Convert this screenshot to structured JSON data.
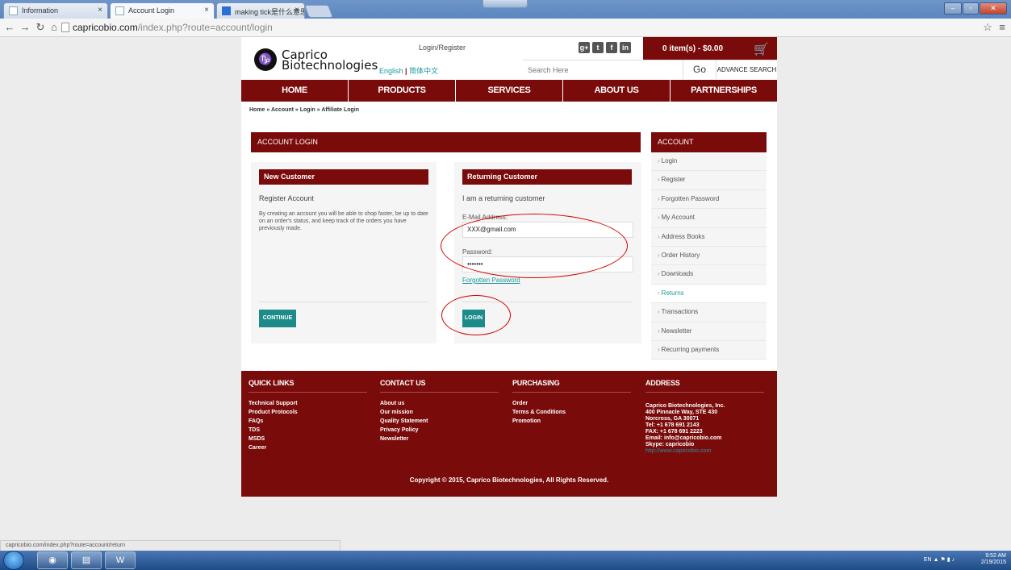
{
  "browser": {
    "tabs": [
      {
        "title": "Information",
        "active": false
      },
      {
        "title": "Account Login",
        "active": true
      },
      {
        "title": "making tick是什么意思_",
        "active": false
      }
    ],
    "tab_close": "×",
    "url_host": "capricobio.com",
    "url_path": "/index.php?route=account/login",
    "status_url": "capricobio.com/index.php?route=account/return"
  },
  "header": {
    "brand_line1": "Caprico",
    "brand_line2": "Biotechnologies",
    "logo_glyph": "♑",
    "login_register": "Login/Register",
    "lang_english": "English",
    "lang_chinese": "简体中文",
    "cart": "0 item(s) - $0.00",
    "search_placeholder": "Search Here",
    "go": "Go",
    "advance_search": "ADVANCE SEARCH",
    "social": [
      "g+",
      "t",
      "f",
      "in"
    ]
  },
  "nav": [
    "HOME",
    "PRODUCTS",
    "SERVICES",
    "ABOUT US",
    "PARTNERSHIPS"
  ],
  "breadcrumb": "Home » Account » Login » Affiliate Login",
  "account_login": {
    "title": "ACCOUNT LOGIN",
    "new_customer": {
      "heading": "New Customer",
      "subtitle": "Register Account",
      "text": "By creating an account you will be able to shop faster, be up to date on an order's status, and keep track of the orders you have previously made.",
      "button": "CONTINUE"
    },
    "returning_customer": {
      "heading": "Returning Customer",
      "subtitle": "I am a returning customer",
      "email_label": "E-Mail Address:",
      "email_value": "XXX@gmail.com",
      "password_label": "Password:",
      "password_value": "•••••••",
      "forgot": "Forgotten Password",
      "button": "LOGIN"
    }
  },
  "sidebar": {
    "title": "ACCOUNT",
    "items": [
      {
        "label": "Login",
        "active": false
      },
      {
        "label": "Register",
        "active": false
      },
      {
        "label": "Forgotten Password",
        "active": false
      },
      {
        "label": "My Account",
        "active": false
      },
      {
        "label": "Address Books",
        "active": false
      },
      {
        "label": "Order History",
        "active": false
      },
      {
        "label": "Downloads",
        "active": false
      },
      {
        "label": "Returns",
        "active": true
      },
      {
        "label": "Transactions",
        "active": false
      },
      {
        "label": "Newsletter",
        "active": false
      },
      {
        "label": "Recurring payments",
        "active": false
      }
    ]
  },
  "footer": {
    "columns": [
      {
        "heading": "QUICK LINKS",
        "links": [
          "Technical Support",
          "Product Protocols",
          "FAQs",
          "TDS",
          "MSDS",
          "Career"
        ]
      },
      {
        "heading": "CONTACT US",
        "links": [
          "About us",
          "Our mission",
          "Quality Statement",
          "Privacy Policy",
          "Newsletter"
        ]
      },
      {
        "heading": "PURCHASING",
        "links": [
          "Order",
          "Terms & Conditions",
          "Promotion"
        ]
      },
      {
        "heading": "ADDRESS",
        "lines": [
          "Caprico Biotechnologies, Inc.",
          "400 Pinnacle Way, STE 430",
          "Norcross, GA 30071",
          "Tel: +1 678 691 2143",
          "FAX: +1 678 691 2223",
          "Email: info@capricobio.com",
          "Skype: capricobio"
        ],
        "url": "http://www.capricobio.com"
      }
    ],
    "copyright": "Copyright © 2015, Caprico Biotechnologies, All Rights Reserved."
  },
  "taskbar": {
    "lang": "EN",
    "time": "9:52 AM",
    "date": "2/19/2015"
  },
  "colors": {
    "brand_red": "#7a0b0b",
    "teal": "#1e8b8b",
    "annotation_red": "#d40000"
  }
}
